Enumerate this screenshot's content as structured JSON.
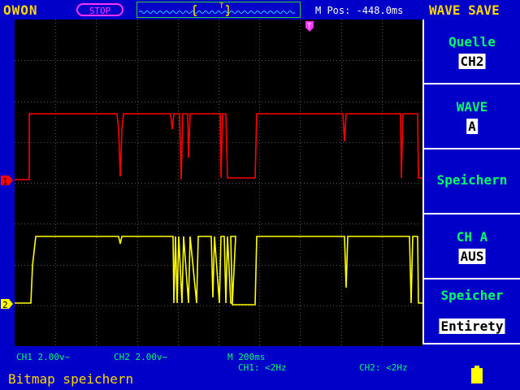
{
  "header": {
    "brand": "OWON",
    "run_state": "STOP",
    "m_pos": "M Pos: -448.0ms",
    "mode_title": "WAVE SAVE",
    "trigger_marker": "T"
  },
  "screen": {
    "ch1_marker": "1",
    "ch2_marker": "2",
    "trigger_marker": "T",
    "ch1_color": "#ff0000",
    "ch2_color": "#ffff00",
    "grid_color": "#555555"
  },
  "menu": [
    {
      "title": "Quelle",
      "value": "CH2"
    },
    {
      "title": "WAVE",
      "value": "A"
    },
    {
      "title": "Speichern",
      "value": ""
    },
    {
      "title": "CH A",
      "value": "AUS"
    },
    {
      "title": "Speicher",
      "value": "Entirety"
    }
  ],
  "status": {
    "ch1_scale": "CH1 2.00v~",
    "ch2_scale": "CH2 2.00v~",
    "timebase": "M  200ms",
    "ch1_freq": "CH1: <2Hz",
    "ch2_freq": "CH2: <2Hz",
    "message": "Bitmap speichern"
  },
  "colors": {
    "background": "#0000c8",
    "label": "#ffd700",
    "accent": "#00ff66",
    "stop": "#ff33ff"
  }
}
